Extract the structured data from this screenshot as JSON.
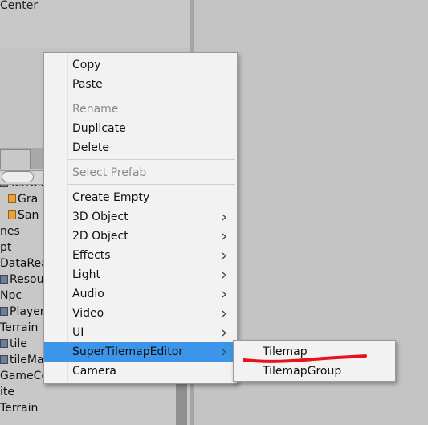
{
  "background": {
    "top_text": "Center",
    "hierarchy_rows": [
      {
        "label": "Terrain",
        "icon": "gameobject-icon",
        "indent": 0
      },
      {
        "label": "Gra",
        "icon": "tilemap-icon",
        "indent": 1
      },
      {
        "label": "San",
        "icon": "tilemap-icon",
        "indent": 1
      },
      {
        "label": "nes",
        "icon": "",
        "indent": 0
      },
      {
        "label": "pt",
        "icon": "",
        "indent": 0
      },
      {
        "label": "DataRea",
        "icon": "",
        "indent": 0
      },
      {
        "label": "Resou",
        "icon": "gameobject-icon",
        "indent": 0
      },
      {
        "label": "Npc",
        "icon": "",
        "indent": 0
      },
      {
        "label": "Player",
        "icon": "gameobject-icon",
        "indent": 0
      },
      {
        "label": "Terrain",
        "icon": "",
        "indent": 0
      },
      {
        "label": "tile",
        "icon": "gameobject-icon",
        "indent": 0
      },
      {
        "label": "tileMan",
        "icon": "gameobject-icon",
        "indent": 0
      },
      {
        "label": "GameCenter",
        "icon": "",
        "indent": 0
      },
      {
        "label": "ite",
        "icon": "",
        "indent": 0
      },
      {
        "label": "Terrain",
        "icon": "",
        "indent": 0
      }
    ]
  },
  "context_menu": {
    "items": [
      {
        "label": "Copy",
        "disabled": false,
        "submenu": false
      },
      {
        "label": "Paste",
        "disabled": false,
        "submenu": false
      },
      {
        "label": "Rename",
        "disabled": true,
        "submenu": false
      },
      {
        "label": "Duplicate",
        "disabled": false,
        "submenu": false
      },
      {
        "label": "Delete",
        "disabled": false,
        "submenu": false
      },
      {
        "label": "Select Prefab",
        "disabled": true,
        "submenu": false
      },
      {
        "label": "Create Empty",
        "disabled": false,
        "submenu": false
      },
      {
        "label": "3D Object",
        "disabled": false,
        "submenu": true
      },
      {
        "label": "2D Object",
        "disabled": false,
        "submenu": true
      },
      {
        "label": "Effects",
        "disabled": false,
        "submenu": true
      },
      {
        "label": "Light",
        "disabled": false,
        "submenu": true
      },
      {
        "label": "Audio",
        "disabled": false,
        "submenu": true
      },
      {
        "label": "Video",
        "disabled": false,
        "submenu": true
      },
      {
        "label": "UI",
        "disabled": false,
        "submenu": true
      },
      {
        "label": "SuperTilemapEditor",
        "disabled": false,
        "submenu": true,
        "highlighted": true
      },
      {
        "label": "Camera",
        "disabled": false,
        "submenu": false
      }
    ]
  },
  "submenu": {
    "items": [
      {
        "label": "Tilemap"
      },
      {
        "label": "TilemapGroup"
      }
    ]
  },
  "colors": {
    "highlight": "#3d95ea",
    "annotation_red": "#e8121b"
  }
}
